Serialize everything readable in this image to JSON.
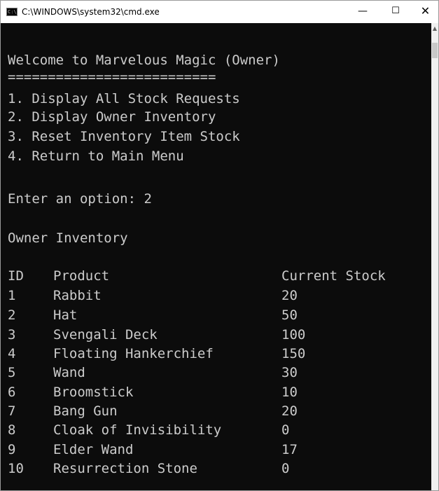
{
  "window": {
    "title": "C:\\WINDOWS\\system32\\cmd.exe",
    "icon_label": "C:\\",
    "minimize_glyph": "—",
    "maximize_glyph": "☐",
    "close_glyph": "✕"
  },
  "console": {
    "welcome": "Welcome to Marvelous Magic (Owner)",
    "separator": "==========================",
    "menu": [
      "1. Display All Stock Requests",
      "2. Display Owner Inventory",
      "3. Reset Inventory Item Stock",
      "4. Return to Main Menu"
    ],
    "prompt": "Enter an option: 2",
    "section_title": "Owner Inventory",
    "table": {
      "headers": {
        "id": "ID",
        "product": "Product",
        "stock": "Current Stock"
      },
      "rows": [
        {
          "id": "1",
          "product": "Rabbit",
          "stock": "20"
        },
        {
          "id": "2",
          "product": "Hat",
          "stock": "50"
        },
        {
          "id": "3",
          "product": "Svengali Deck",
          "stock": "100"
        },
        {
          "id": "4",
          "product": "Floating Hankerchief",
          "stock": "150"
        },
        {
          "id": "5",
          "product": "Wand",
          "stock": "30"
        },
        {
          "id": "6",
          "product": "Broomstick",
          "stock": "10"
        },
        {
          "id": "7",
          "product": "Bang Gun",
          "stock": "20"
        },
        {
          "id": "8",
          "product": "Cloak of Invisibility",
          "stock": "0"
        },
        {
          "id": "9",
          "product": "Elder Wand",
          "stock": "17"
        },
        {
          "id": "10",
          "product": "Resurrection Stone",
          "stock": "0"
        }
      ]
    }
  },
  "colors": {
    "console_bg": "#0c0c0c",
    "console_text": "#cccccc",
    "titlebar_bg": "#ffffff"
  },
  "icons": {
    "app": "cmd-icon",
    "scroll_up": "scroll-up-arrow-icon"
  }
}
